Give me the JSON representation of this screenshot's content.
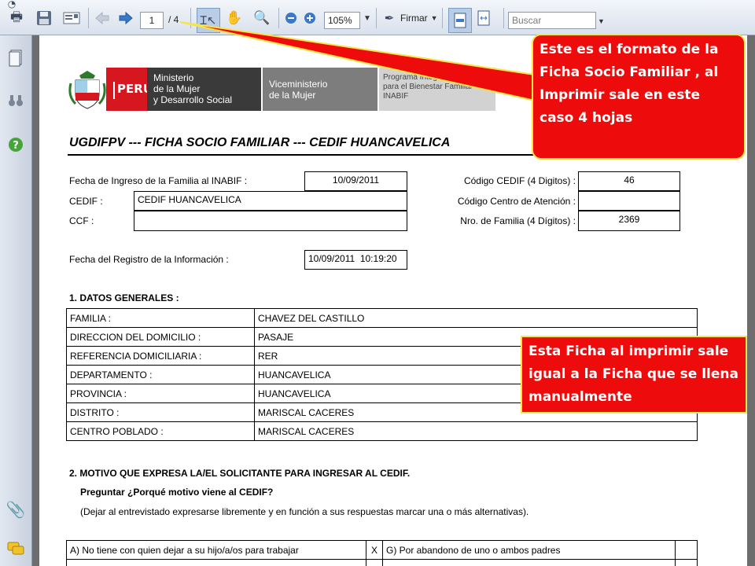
{
  "toolbar": {
    "print_icon": "printer-icon",
    "save_icon": "floppy-disk-icon",
    "email_icon": "email-icon",
    "page_current": "1",
    "page_total": "/ 4",
    "zoom_value": "105%",
    "sign_label": "Firmar",
    "search_placeholder": "Buscar"
  },
  "header": {
    "peru_label": "PERÚ",
    "ministry": [
      "Ministerio",
      "de la Mujer",
      "y Desarrollo Social"
    ],
    "vice_ministry": [
      "Viceministerio",
      "de la Mujer"
    ],
    "program": [
      "Programa Integral Nacional",
      "para el Bienestar Familiar",
      "INABIF"
    ]
  },
  "form": {
    "title": "UGDIFPV --- FICHA SOCIO FAMILIAR --- CEDIF HUANCAVELICA",
    "fecha_ingreso_label": "Fecha de Ingreso de la Familia al INABIF :",
    "fecha_ingreso_value": "10/09/2011",
    "cedif_label": "CEDIF :",
    "cedif_value": "CEDIF HUANCAVELICA",
    "ccf_label": "CCF :",
    "ccf_value": "",
    "codigo_cedif_label": "Código CEDIF (4 Digitos) :",
    "codigo_cedif_value": "46",
    "codigo_centro_label": "Código Centro de Atención :",
    "codigo_centro_value": "",
    "nro_familia_label": "Nro. de Familia (4 Dígitos) :",
    "nro_familia_value": "2369",
    "fecha_registro_label": "Fecha del Registro de la Información :",
    "fecha_registro_value": "10/09/2011  10:19:20",
    "section1_title": "1. DATOS GENERALES :",
    "general_rows": [
      {
        "label": "FAMILIA :",
        "value": "CHAVEZ DEL CASTILLO"
      },
      {
        "label": "DIRECCION DEL DOMICILIO :",
        "value": "PASAJE"
      },
      {
        "label": "REFERENCIA DOMICILIARIA :",
        "value": "RER"
      },
      {
        "label": "DEPARTAMENTO :",
        "value": "HUANCAVELICA"
      },
      {
        "label": "PROVINCIA :",
        "value": "HUANCAVELICA"
      },
      {
        "label": "DISTRITO :",
        "value": "MARISCAL CACERES"
      },
      {
        "label": "CENTRO POBLADO :",
        "value": "MARISCAL CACERES"
      }
    ],
    "section2_title": "2. MOTIVO QUE EXPRESA LA/EL SOLICITANTE PARA INGRESAR AL CEDIF.",
    "section2_question": "Preguntar ¿Porqué motivo viene al CEDIF?",
    "section2_instruction": "(Dejar al entrevistado expresarse libremente y en función a sus respuestas marcar una o más alternativas).",
    "motivos_row": {
      "a": "A) No tiene con quien dejar a su hijo/a/os para trabajar",
      "mark_a": "X",
      "g": "G) Por abandono de uno o ambos padres",
      "mark_g": ""
    }
  },
  "callouts": {
    "top": "Este es el formato de la Ficha Socio Familiar , al Imprimir sale en este caso 4 hojas",
    "middle": "Esta Ficha al imprimir sale igual a la Ficha que se llena manualmente"
  },
  "colors": {
    "callout_fill": "#ee0b0b",
    "callout_border": "#f7e44a",
    "peru_red": "#d7171f"
  }
}
